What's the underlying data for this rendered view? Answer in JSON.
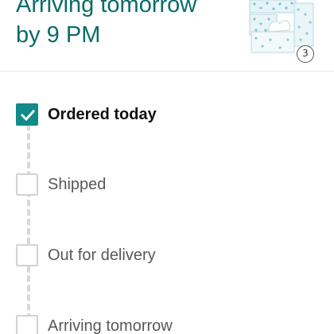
{
  "header": {
    "headline_line1": "Arriving tomorrow",
    "headline_line2": "by 9 PM",
    "accent_color": "#0b6a6a"
  },
  "product": {
    "image_icon": "tissue-box-pack-image",
    "quantity": "3"
  },
  "tracker": {
    "steps": [
      {
        "label": "Ordered today",
        "completed": true
      },
      {
        "label": "Shipped",
        "completed": false
      },
      {
        "label": "Out for delivery",
        "completed": false
      },
      {
        "label": "Arriving tomorrow",
        "completed": false
      }
    ],
    "complete_color": "#118a8a"
  }
}
